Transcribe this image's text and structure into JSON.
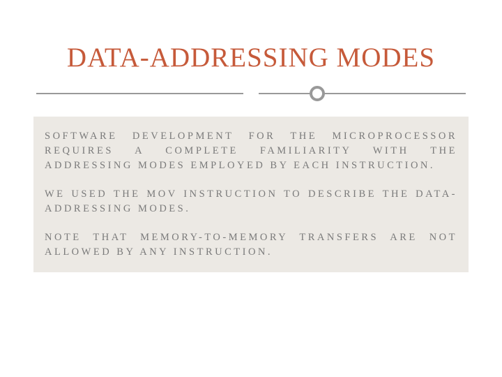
{
  "title": "DATA-ADDRESSING MODES",
  "paragraphs": {
    "p1": "SOFTWARE DEVELOPMENT FOR THE MICROPROCESSOR REQUIRES A COMPLETE FAMILIARITY WITH THE ADDRESSING MODES EMPLOYED BY EACH INSTRUCTION.",
    "p2": "WE USED THE MOV INSTRUCTION TO DESCRIBE THE DATA-ADDRESSING MODES.",
    "p3": "NOTE THAT MEMORY-TO-MEMORY TRANSFERS ARE NOT ALLOWED BY ANY INSTRUCTION."
  }
}
